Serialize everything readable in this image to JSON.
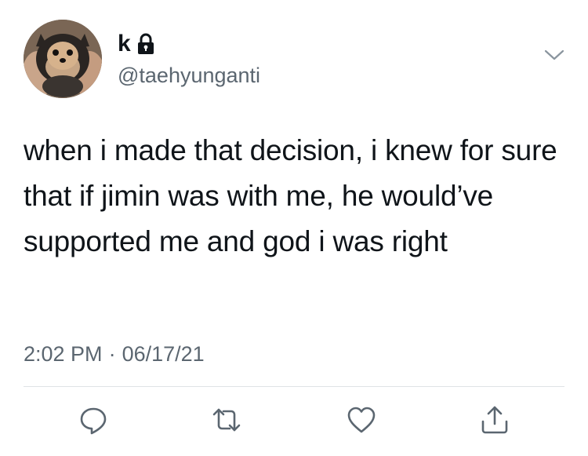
{
  "user": {
    "display_name": "k",
    "handle": "@taehyunganti",
    "avatar_icon": "avatar-dog-photo",
    "locked_icon": "lock-icon"
  },
  "tweet": {
    "text": "when i made that decision, i knew for sure that if jimin was with me, he would’ve supported me and god i was right",
    "time": "2:02 PM",
    "separator": "·",
    "date": "06/17/21"
  },
  "actions": {
    "reply_icon": "reply-icon",
    "retweet_icon": "retweet-icon",
    "like_icon": "like-icon",
    "share_icon": "share-icon"
  },
  "colors": {
    "text_primary": "#0f1419",
    "text_secondary": "#5b6670",
    "icon": "#5b6670",
    "divider": "#dfe3e6"
  }
}
